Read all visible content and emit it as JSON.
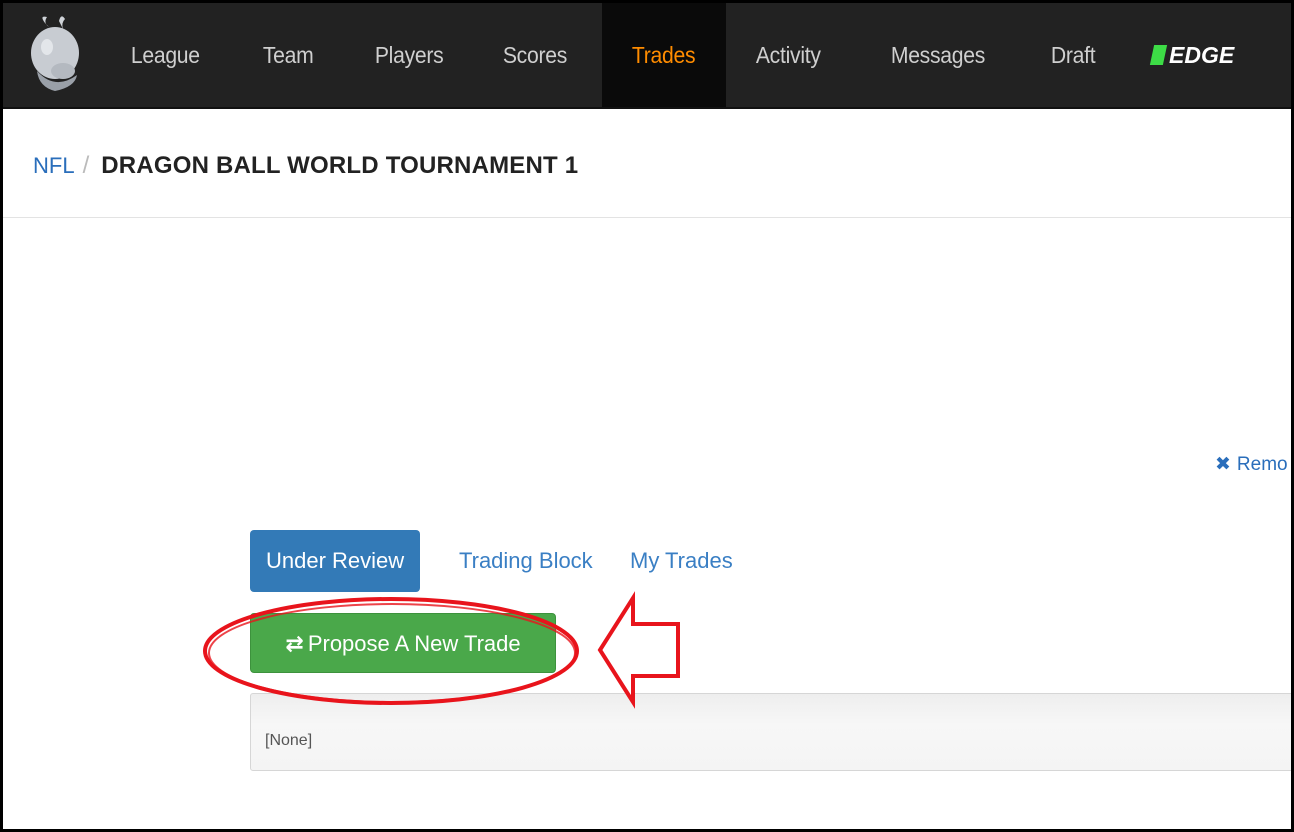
{
  "nav": {
    "items": [
      {
        "label": "League"
      },
      {
        "label": "Team"
      },
      {
        "label": "Players"
      },
      {
        "label": "Scores"
      },
      {
        "label": "Trades",
        "active": true
      },
      {
        "label": "Activity"
      },
      {
        "label": "Messages"
      },
      {
        "label": "Draft"
      }
    ],
    "edge_label": "EDGE",
    "active_color": "#ff8c00",
    "edge_accent": "#3ddc46"
  },
  "breadcrumb": {
    "root": "NFL",
    "separator": "/",
    "current": "DRAGON BALL WORLD TOURNAMENT 1"
  },
  "remove_link": {
    "icon": "times-icon",
    "label": "Remo"
  },
  "tabs": [
    {
      "label": "Under Review",
      "active": true
    },
    {
      "label": "Trading Block"
    },
    {
      "label": "My Trades"
    }
  ],
  "actions": {
    "propose_icon": "exchange-icon",
    "propose_label": "Propose A New Trade",
    "button_color": "#4aa84a"
  },
  "panel": {
    "empty_text": "[None]"
  },
  "annotation": {
    "color": "#e8141c",
    "shapes": [
      "ellipse-highlight",
      "arrow-left"
    ]
  }
}
